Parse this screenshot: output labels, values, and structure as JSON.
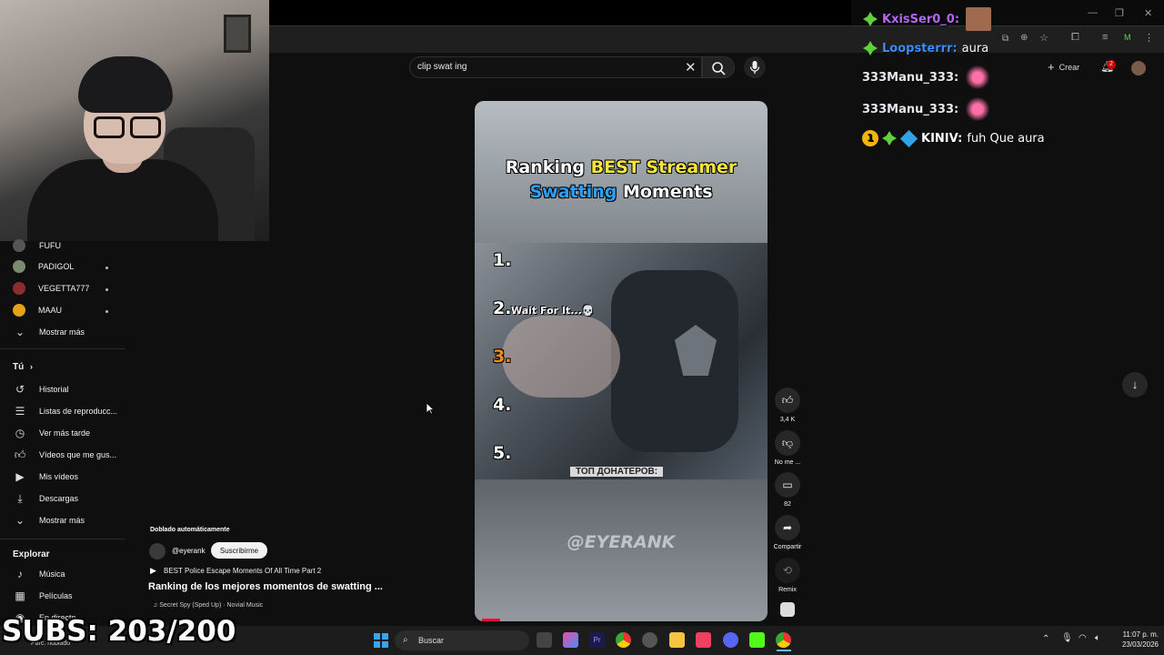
{
  "search": {
    "query": "clip swat ing"
  },
  "browser": {
    "crear_label": "Crear",
    "notif_count": "2"
  },
  "sidebar": {
    "subscriptions": [
      {
        "label": "FUFU"
      },
      {
        "label": "PADIGOL"
      },
      {
        "label": "VEGETTA777"
      },
      {
        "label": "MAAU"
      }
    ],
    "show_more_1": "Mostrar más",
    "you_heading": "Tú",
    "you_items": [
      {
        "label": "Historial",
        "icon": "history-icon"
      },
      {
        "label": "Listas de reproducc...",
        "icon": "playlists-icon"
      },
      {
        "label": "Ver más tarde",
        "icon": "watch-later-icon"
      },
      {
        "label": "Vídeos que me gus...",
        "icon": "liked-videos-icon"
      },
      {
        "label": "Mis vídeos",
        "icon": "my-videos-icon"
      },
      {
        "label": "Descargas",
        "icon": "downloads-icon"
      }
    ],
    "show_more_2": "Mostrar más",
    "explore_heading": "Explorar",
    "explore_items": [
      {
        "label": "Música",
        "icon": "music-icon"
      },
      {
        "label": "Películas",
        "icon": "movies-icon"
      },
      {
        "label": "En directo",
        "icon": "live-icon"
      }
    ]
  },
  "short": {
    "title_line1_a": "Ranking ",
    "title_line1_b": "BEST Streamer",
    "title_line2_a": "Swatting",
    "title_line2_b": " Moments",
    "ranks": [
      "1.",
      "2.",
      "3.",
      "4.",
      "5."
    ],
    "wait_text": "Wait For It...💀",
    "overlay_cyrillic": "ТОП ДОНАТЕРОВ:",
    "watermark": "@EYERANK"
  },
  "actions": {
    "like_count": "3,4 K",
    "dislike_label": "No me ...",
    "comments_count": "82",
    "share_label": "Compartir",
    "remix_label": "Remix"
  },
  "info": {
    "dubbed_label": "Doblado automáticamente",
    "channel": "@eyerank",
    "subscribe_label": "Suscribirme",
    "related": "BEST Police Escape Moments Of All Time Part 2",
    "title": "Ranking de los mejores momentos de swatting ...",
    "music": "♫ Secret Spy (Sped Up) · Novial Music"
  },
  "chat": [
    {
      "name": "KxisSer0_0:",
      "msg": "",
      "color": "#b267f5"
    },
    {
      "name": "Loopsterrr:",
      "msg": "aura",
      "color": "#3a8cff"
    },
    {
      "name": "333Manu_333:",
      "msg": "",
      "color": "#e9e6f0"
    },
    {
      "name": "333Manu_333:",
      "msg": "",
      "color": "#e9e6f0"
    },
    {
      "name": "KINIV:",
      "msg": "fuh Que aura",
      "color": "#ffffff"
    }
  ],
  "overlay": {
    "subs": "SUBS: 203/200"
  },
  "taskbar": {
    "search_label": "Buscar",
    "weather": "Parc. nublado",
    "time": "11:07 p. m.",
    "date": "23/03/2026"
  },
  "colors": {
    "accent": "#ff0033",
    "chat_badge_green": "#5fd13a"
  }
}
